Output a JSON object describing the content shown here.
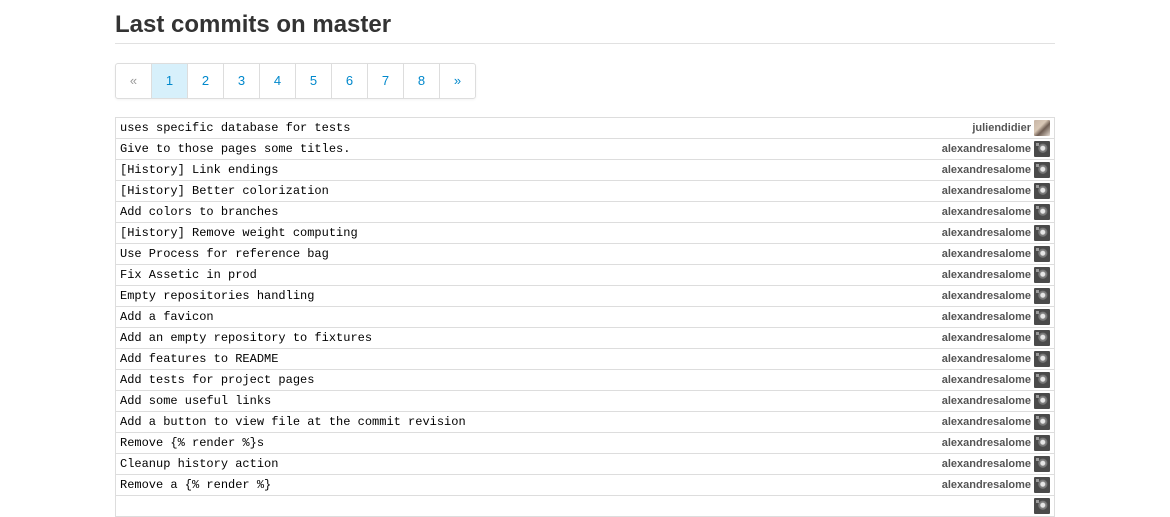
{
  "page": {
    "title": "Last commits on master"
  },
  "pagination": {
    "prev": "«",
    "next": "»",
    "pages": [
      "1",
      "2",
      "3",
      "4",
      "5",
      "6",
      "7",
      "8"
    ],
    "current": "1"
  },
  "commits": [
    {
      "message": "uses specific database for tests",
      "author": "juliendidier",
      "avatar": "photo"
    },
    {
      "message": "Give to those pages some titles.",
      "author": "alexandresalome",
      "avatar": "gray"
    },
    {
      "message": "[History] Link endings",
      "author": "alexandresalome",
      "avatar": "gray"
    },
    {
      "message": "[History] Better colorization",
      "author": "alexandresalome",
      "avatar": "gray"
    },
    {
      "message": "Add colors to branches",
      "author": "alexandresalome",
      "avatar": "gray"
    },
    {
      "message": "[History] Remove weight computing",
      "author": "alexandresalome",
      "avatar": "gray"
    },
    {
      "message": "Use Process for reference bag",
      "author": "alexandresalome",
      "avatar": "gray"
    },
    {
      "message": "Fix Assetic in prod",
      "author": "alexandresalome",
      "avatar": "gray"
    },
    {
      "message": "Empty repositories handling",
      "author": "alexandresalome",
      "avatar": "gray"
    },
    {
      "message": "Add a favicon",
      "author": "alexandresalome",
      "avatar": "gray"
    },
    {
      "message": "Add an empty repository to fixtures",
      "author": "alexandresalome",
      "avatar": "gray"
    },
    {
      "message": "Add features to README",
      "author": "alexandresalome",
      "avatar": "gray"
    },
    {
      "message": "Add tests for project pages",
      "author": "alexandresalome",
      "avatar": "gray"
    },
    {
      "message": "Add some useful links",
      "author": "alexandresalome",
      "avatar": "gray"
    },
    {
      "message": "Add a button to view file at the commit revision",
      "author": "alexandresalome",
      "avatar": "gray"
    },
    {
      "message": "Remove {% render %}s",
      "author": "alexandresalome",
      "avatar": "gray"
    },
    {
      "message": "Cleanup history action",
      "author": "alexandresalome",
      "avatar": "gray"
    },
    {
      "message": "Remove a {% render %}",
      "author": "alexandresalome",
      "avatar": "gray"
    },
    {
      "message": "",
      "author": "",
      "avatar": "gray"
    }
  ]
}
